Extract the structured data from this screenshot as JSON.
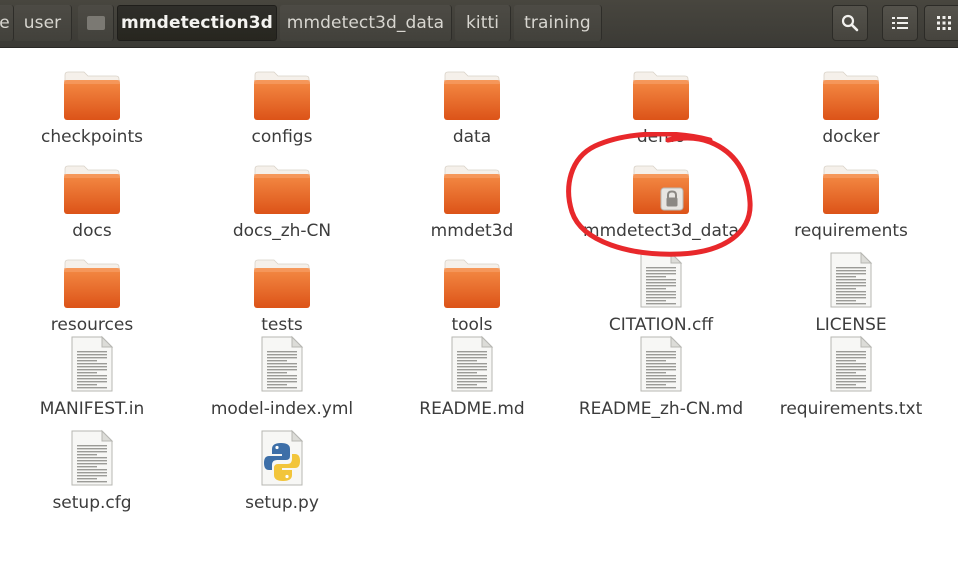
{
  "window": {
    "breadcrumbs": [
      {
        "label": "e",
        "active": false
      },
      {
        "label": "user",
        "active": false
      },
      {
        "label": "",
        "active": false
      },
      {
        "label": "mmdetection3d",
        "active": true
      },
      {
        "label": "mmdetect3d_data",
        "active": false
      },
      {
        "label": "kitti",
        "active": false
      },
      {
        "label": "training",
        "active": false
      }
    ],
    "toolbar_icons": [
      "search-icon",
      "list-view-icon",
      "grid-view-icon"
    ]
  },
  "files": [
    {
      "name": "checkpoints",
      "kind": "folder"
    },
    {
      "name": "configs",
      "kind": "folder"
    },
    {
      "name": "data",
      "kind": "folder"
    },
    {
      "name": "demo",
      "kind": "folder"
    },
    {
      "name": "docker",
      "kind": "folder"
    },
    {
      "name": "docs",
      "kind": "folder"
    },
    {
      "name": "docs_zh-CN",
      "kind": "folder"
    },
    {
      "name": "mmdet3d",
      "kind": "folder"
    },
    {
      "name": "mmdetect3d_data",
      "kind": "folder-locked"
    },
    {
      "name": "requirements",
      "kind": "folder"
    },
    {
      "name": "resources",
      "kind": "folder"
    },
    {
      "name": "tests",
      "kind": "folder"
    },
    {
      "name": "tools",
      "kind": "folder"
    },
    {
      "name": "CITATION.cff",
      "kind": "text"
    },
    {
      "name": "LICENSE",
      "kind": "text"
    },
    {
      "name": "MANIFEST.in",
      "kind": "text"
    },
    {
      "name": "model-index.yml",
      "kind": "text"
    },
    {
      "name": "README.md",
      "kind": "text"
    },
    {
      "name": "README_zh-CN.md",
      "kind": "text"
    },
    {
      "name": "requirements.txt",
      "kind": "text"
    },
    {
      "name": "setup.cfg",
      "kind": "text"
    },
    {
      "name": "setup.py",
      "kind": "python"
    }
  ],
  "colors": {
    "header": "#3b3a35",
    "folder_top": "#f0803e",
    "folder_bottom": "#e0561a",
    "annotation": "#e8282b",
    "label": "#3c3c3c"
  }
}
